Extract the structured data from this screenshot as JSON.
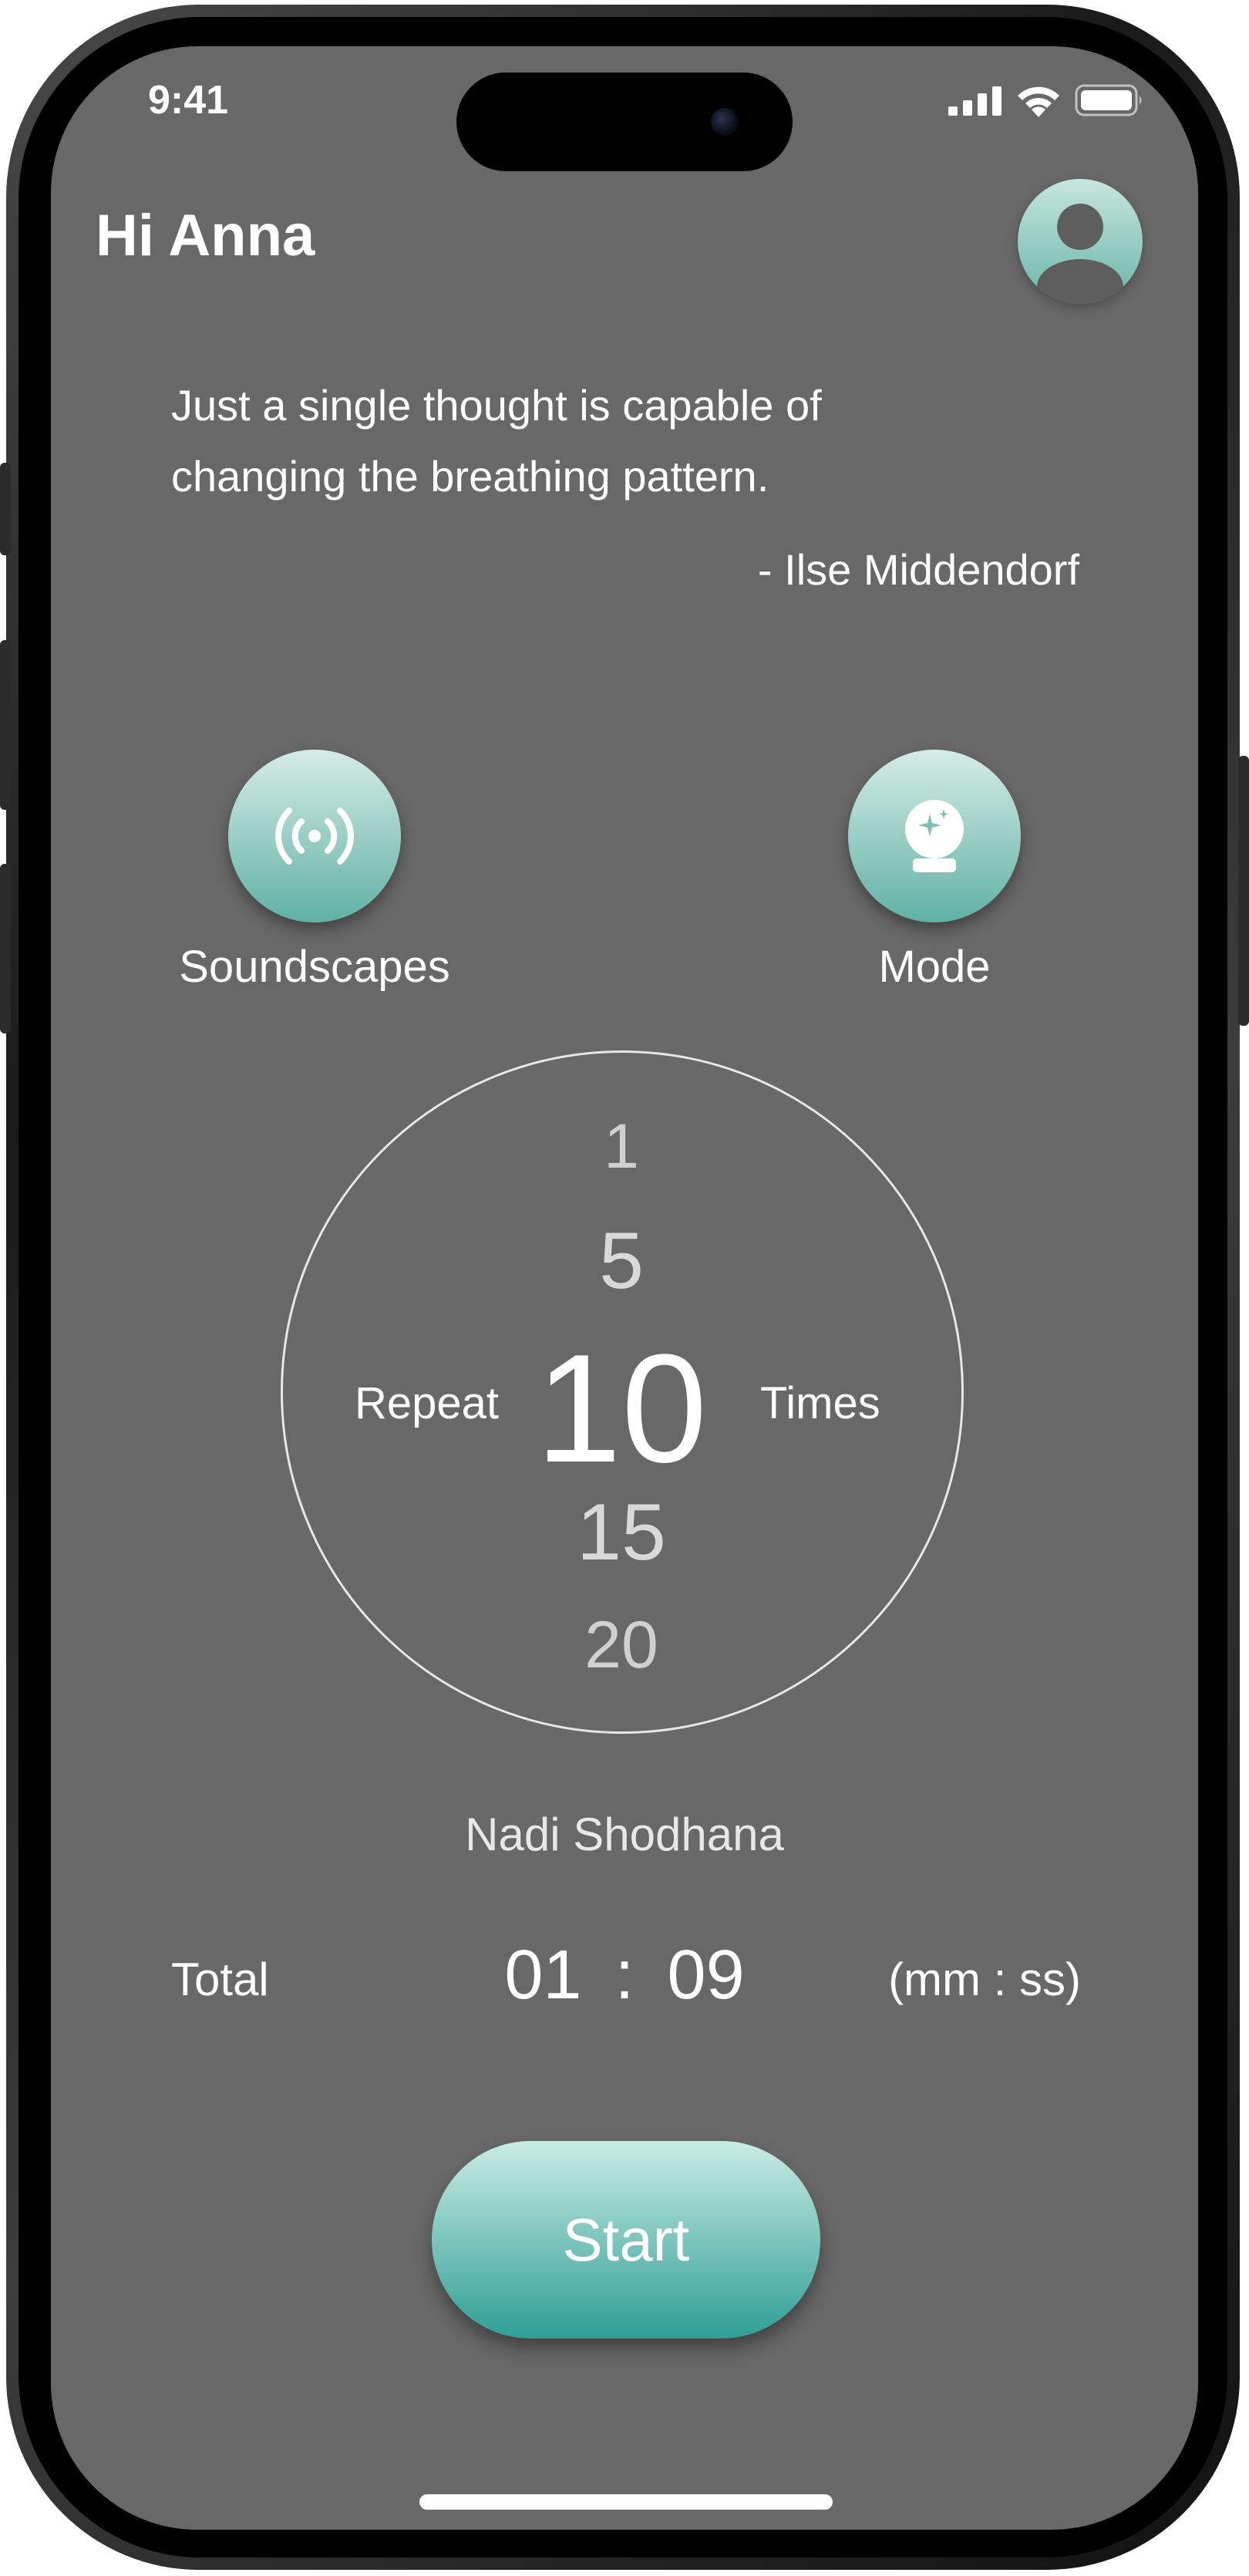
{
  "status_bar": {
    "time": "9:41"
  },
  "header": {
    "greeting": "Hi Anna"
  },
  "quote": {
    "text": "Just a single thought is capable of changing the breathing pattern.",
    "author": "- Ilse Middendorf"
  },
  "options": {
    "soundscapes_label": "Soundscapes",
    "mode_label": "Mode"
  },
  "repeat_picker": {
    "prefix": "Repeat",
    "suffix": "Times",
    "values": [
      "1",
      "5",
      "10",
      "15",
      "20"
    ],
    "selected": "10"
  },
  "technique": "Nadi Shodhana",
  "total": {
    "label": "Total",
    "minutes": "01",
    "separator": ":",
    "seconds": "09",
    "unit": "(mm : ss)"
  },
  "start_label": "Start",
  "colors": {
    "screen_bg": "#686868",
    "accent_light": "#c9ece4",
    "accent_dark": "#2f9f96"
  }
}
